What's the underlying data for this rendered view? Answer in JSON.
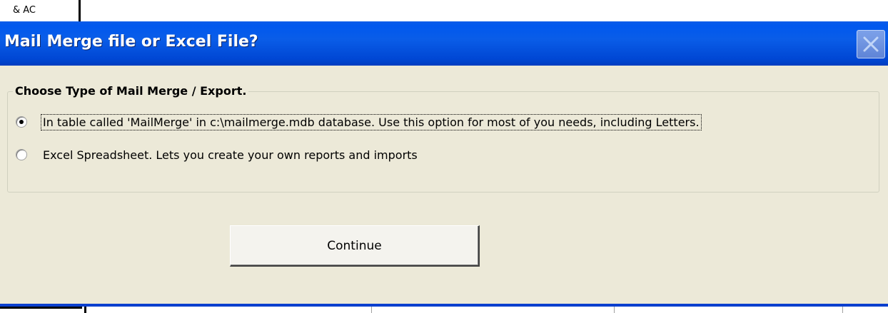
{
  "background": {
    "partial_text": "& AC"
  },
  "dialog": {
    "title": "Mail Merge file or Excel File?",
    "close_icon": "close-icon",
    "group": {
      "label": "Choose Type of Mail Merge / Export.",
      "options": [
        {
          "label": "In table called 'MailMerge' in c:\\mailmerge.mdb database.  Use this option for most of you needs, including Letters.",
          "selected": true
        },
        {
          "label": "Excel Spreadsheet.  Lets you create your own reports and imports",
          "selected": false
        }
      ]
    },
    "continue_label": "Continue"
  },
  "colors": {
    "titlebar": "#0058ee",
    "dialog_bg": "#ece9d8",
    "border_accent": "#0a3fce"
  }
}
